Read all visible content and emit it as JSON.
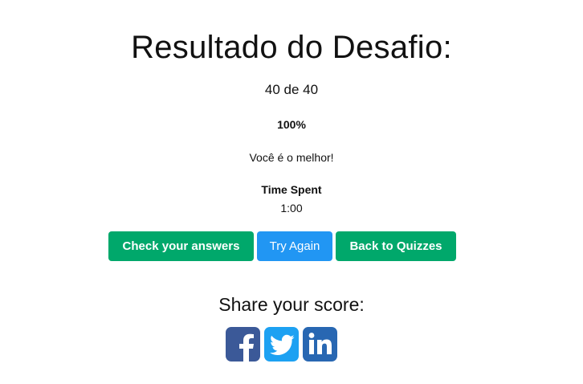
{
  "result": {
    "title": "Resultado do Desafio:",
    "score": "40 de 40",
    "percent": "100%",
    "message": "Você é o melhor!",
    "time_label": "Time Spent",
    "time_value": "1:00"
  },
  "buttons": {
    "check_answers": "Check your answers",
    "try_again": "Try Again",
    "back_to_quizzes": "Back to Quizzes"
  },
  "share": {
    "label": "Share your score:",
    "icons": [
      "facebook-icon",
      "twitter-icon",
      "linkedin-icon"
    ]
  },
  "colors": {
    "green": "#00a86b",
    "blue": "#2196f3",
    "facebook": "#3b5998",
    "twitter": "#1da1f2",
    "linkedin": "#2867b2"
  }
}
